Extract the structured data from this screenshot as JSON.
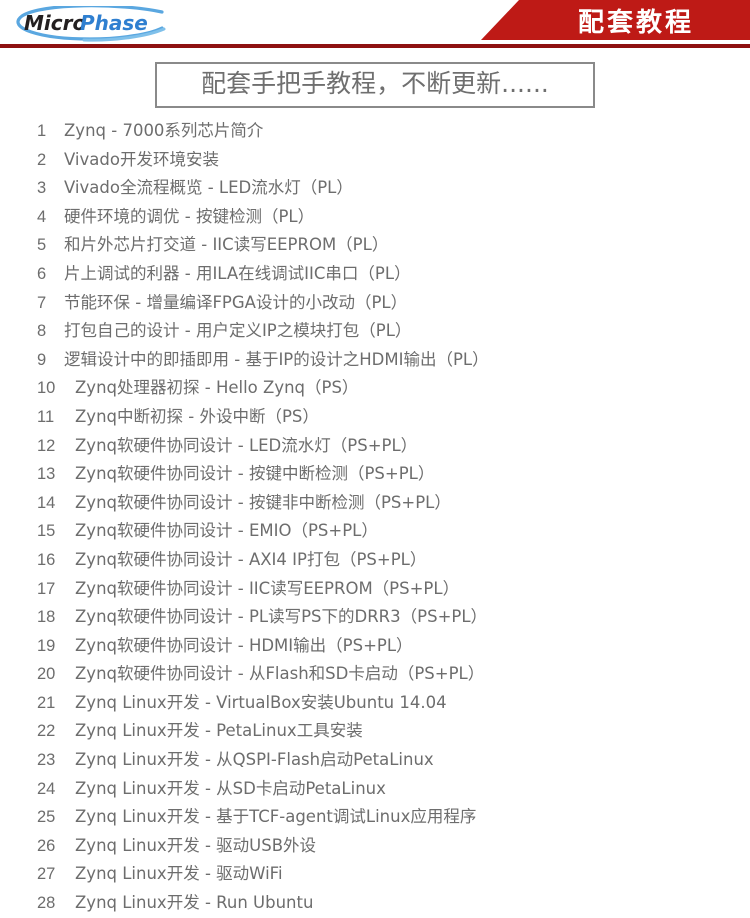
{
  "header": {
    "logo": {
      "name": "MicroPhase",
      "part_dark": "Micro",
      "part_blue": "Phase",
      "dark_color": "#231f20",
      "blue_color": "#2f7fd0",
      "swoosh_color": "#5aa7e0"
    },
    "banner_label": "配套教程",
    "banner_color": "#be1a16",
    "banner_color_dark": "#8e1111",
    "banner_text_color": "#ffffff"
  },
  "title": {
    "text": "配套手把手教程，不断更新......",
    "border_color": "#8a8a8a",
    "text_color": "#6f6f6f"
  },
  "list": {
    "text_color": "#6d6d6d",
    "items": [
      {
        "num": "1",
        "text": "Zynq - 7000系列芯片简介"
      },
      {
        "num": "2",
        "text": "Vivado开发环境安装"
      },
      {
        "num": "3",
        "text": "Vivado全流程概览 - LED流水灯（PL）"
      },
      {
        "num": "4",
        "text": "硬件环境的调优 - 按键检测（PL）"
      },
      {
        "num": "5",
        "text": "和片外芯片打交道 - IIC读写EEPROM（PL）"
      },
      {
        "num": "6",
        "text": "片上调试的利器 - 用ILA在线调试IIC串口（PL）"
      },
      {
        "num": "7",
        "text": "节能环保 - 增量编译FPGA设计的小改动（PL）"
      },
      {
        "num": "8",
        "text": "打包自己的设计 - 用户定义IP之模块打包（PL）"
      },
      {
        "num": "9",
        "text": "逻辑设计中的即插即用 - 基于IP的设计之HDMI输出（PL）"
      },
      {
        "num": "10",
        "text": "Zynq处理器初探 - Hello Zynq（PS）"
      },
      {
        "num": "11",
        "text": "Zynq中断初探 - 外设中断（PS）"
      },
      {
        "num": "12",
        "text": "Zynq软硬件协同设计 - LED流水灯（PS+PL）"
      },
      {
        "num": "13",
        "text": "Zynq软硬件协同设计 - 按键中断检测（PS+PL）"
      },
      {
        "num": "14",
        "text": "Zynq软硬件协同设计 - 按键非中断检测（PS+PL）"
      },
      {
        "num": "15",
        "text": "Zynq软硬件协同设计 - EMIO（PS+PL）"
      },
      {
        "num": "16",
        "text": "Zynq软硬件协同设计 - AXI4 IP打包（PS+PL）"
      },
      {
        "num": "17",
        "text": "Zynq软硬件协同设计 - IIC读写EEPROM（PS+PL）"
      },
      {
        "num": "18",
        "text": "Zynq软硬件协同设计 - PL读写PS下的DRR3（PS+PL）"
      },
      {
        "num": "19",
        "text": "Zynq软硬件协同设计 - HDMI输出（PS+PL）"
      },
      {
        "num": "20",
        "text": "Zynq软硬件协同设计 - 从Flash和SD卡启动（PS+PL）"
      },
      {
        "num": "21",
        "text": "Zynq Linux开发 - VirtualBox安装Ubuntu 14.04"
      },
      {
        "num": "22",
        "text": "Zynq Linux开发 - PetaLinux工具安装"
      },
      {
        "num": "23",
        "text": "Zynq Linux开发 - 从QSPI-Flash启动PetaLinux"
      },
      {
        "num": "24",
        "text": "Zynq Linux开发 - 从SD卡启动PetaLinux"
      },
      {
        "num": "25",
        "text": "Zynq Linux开发 - 基于TCF-agent调试Linux应用程序"
      },
      {
        "num": "26",
        "text": "Zynq Linux开发 - 驱动USB外设"
      },
      {
        "num": "27",
        "text": "Zynq Linux开发 - 驱动WiFi"
      },
      {
        "num": "28",
        "text": "Zynq Linux开发 - Run Ubuntu"
      }
    ]
  }
}
